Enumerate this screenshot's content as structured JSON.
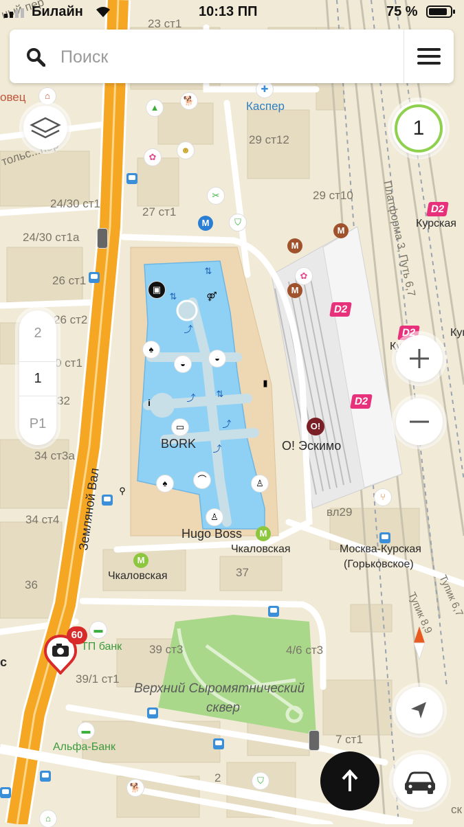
{
  "status_bar": {
    "carrier": "Билайн",
    "time": "10:13 ПП",
    "battery": "75 %"
  },
  "search": {
    "placeholder": "Поиск"
  },
  "floors": {
    "levels": [
      "2",
      "1",
      "P1"
    ],
    "active": "1"
  },
  "traffic_level": "1",
  "speed_camera": {
    "limit": "60"
  },
  "map_labels": {
    "addresses": [
      "23 ст1",
      "29 ст12",
      "29 ст10",
      "27 ст1",
      "24/30 ст1",
      "24/30 ст1а",
      "26 ст1",
      "26 ст2",
      "0 ст1",
      "32",
      "34 ст3а",
      "34 ст4",
      "36",
      "37",
      "39 ст3",
      "4/6 ст3",
      "39/1 ст1",
      "7 ст1",
      "2",
      "вл29",
      "ск"
    ],
    "streets": [
      "Земляной Вал",
      "тольс...пер",
      "ный пер",
      "Платформа 3, Путь 6,7",
      "Тупик 6,7",
      "Тупик 8,9"
    ],
    "places": [
      "BORK",
      "Hugo Boss",
      "О! Эскимо",
      "Каспер",
      "Курская",
      "Кур",
      "Куп"
    ],
    "metro": [
      "Чкаловская",
      "Чкаловская"
    ],
    "station": [
      "Москва-Курская",
      "(Горьковское)"
    ],
    "banks": [
      "ТП банк",
      "Альфа-Банк"
    ],
    "park": [
      "Верхний Сыромятнический",
      "сквер"
    ],
    "d2": "D2",
    "metro_letter": "M",
    "partial": [
      "овец",
      "с"
    ]
  },
  "colors": {
    "road_orange": "#f5a623",
    "mall_blue": "#8fd0f5",
    "park_green": "#a9d88a",
    "metro_green": "#8dc63f",
    "metro_brown": "#a0522d",
    "d2_pink": "#e8317b",
    "accent_blue": "#3a8fd8"
  },
  "icons": [
    "search-icon",
    "menu-icon",
    "layers-icon",
    "compass-icon",
    "location-arrow-icon",
    "car-icon",
    "arrow-up-icon",
    "camera-icon",
    "zoom-in-icon",
    "zoom-out-icon"
  ]
}
